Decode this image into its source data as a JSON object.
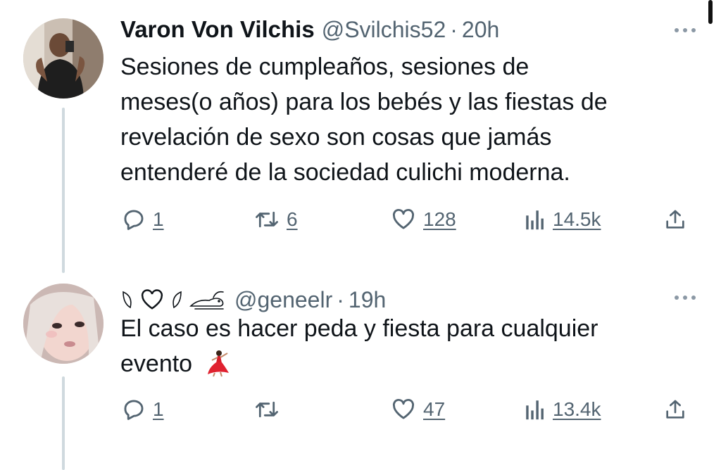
{
  "tweets": [
    {
      "name": "Varon Von Vilchis",
      "handle": "@Svilchis52",
      "separator": "·",
      "time": "20h",
      "lines": [
        "Sesiones de cumpleaños, sesiones de",
        "meses(o años) para los bebés y las fiestas de",
        "revelación de sexo son cosas que jamás",
        "entenderé de la sociedad culichi moderna."
      ],
      "stats": {
        "replies": "1",
        "retweets": "6",
        "likes": "128",
        "views": "14.5k"
      }
    },
    {
      "name_glyphs": [
        "leaf-icon",
        "heart-outline-icon",
        "leaf-icon",
        "hare-icon"
      ],
      "handle": "@geneelr",
      "separator": "·",
      "time": "19h",
      "lines": [
        "El caso es hacer peda y fiesta para cualquier",
        "evento"
      ],
      "emoji": "dancing-woman-emoji",
      "stats": {
        "replies": "1",
        "retweets": "",
        "likes": "47",
        "views": "13.4k"
      }
    }
  ],
  "colors": {
    "text": "#0f1419",
    "secondary": "#536471",
    "thread_line": "#cfd9de"
  }
}
